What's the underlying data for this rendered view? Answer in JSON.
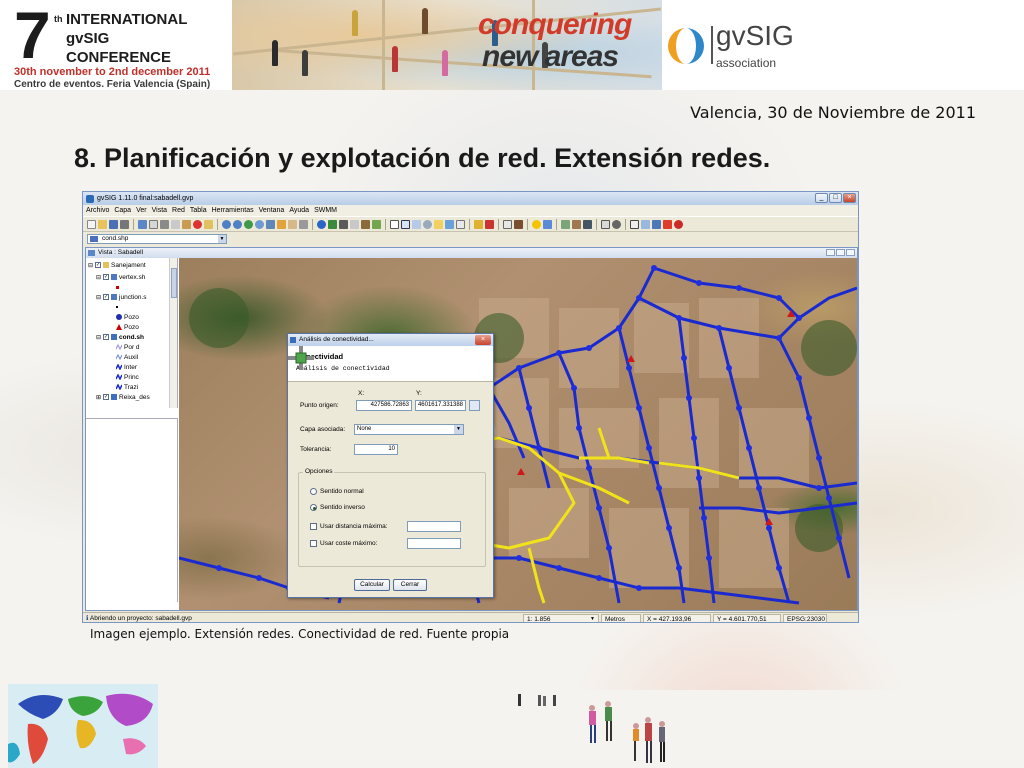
{
  "banner": {
    "seven": "7",
    "th": "th",
    "line1": "INTERNATIONAL",
    "line2": "gvSIG",
    "line3": "CONFERENCE",
    "dates": "30th november to 2nd december 2011",
    "venue": "Centro de eventos. Feria Valencia (Spain)",
    "slogan_line1": "conquering",
    "slogan_line2": "new areas",
    "org_name": "gvSIG",
    "org_subtitle": "association"
  },
  "date_line": "Valencia, 30 de Noviembre de 2011",
  "slide_title": "8. Planificación y explotación de red. Extensión redes.",
  "caption": "Imagen ejemplo. Extensión redes. Conectividad de red. Fuente propia",
  "app": {
    "title": "gvSIG 1.11.0 final:sabadell.gvp",
    "menu": [
      "Archivo",
      "Capa",
      "Ver",
      "Vista",
      "Red",
      "Tabla",
      "Herramientas",
      "Ventana",
      "Ayuda",
      "SWMM"
    ],
    "layer_combo": "cond.shp",
    "view_title": "Vista : Sabadell",
    "toc": [
      {
        "label": "Sanejament",
        "indent": 0,
        "symbol": "folder"
      },
      {
        "label": "vertex.sh",
        "indent": 1,
        "symbol": "layer"
      },
      {
        "label": "junction.s",
        "indent": 1,
        "symbol": "layer"
      },
      {
        "label": "Pozo",
        "indent": 2,
        "symbol": "circle"
      },
      {
        "label": "Pozo",
        "indent": 2,
        "symbol": "triangle"
      },
      {
        "label": "cond.sh",
        "indent": 1,
        "symbol": "layer"
      },
      {
        "label": "Por d",
        "indent": 2,
        "symbol": "line"
      },
      {
        "label": "Auxil",
        "indent": 2,
        "symbol": "line"
      },
      {
        "label": "Inter",
        "indent": 2,
        "symbol": "line"
      },
      {
        "label": "Princ",
        "indent": 2,
        "symbol": "line"
      },
      {
        "label": "Trazi",
        "indent": 2,
        "symbol": "line"
      },
      {
        "label": "Reixa_des",
        "indent": 1,
        "symbol": "layer"
      }
    ],
    "status": {
      "message": "Abriendo un proyecto: sabadell.gvp",
      "scale": "1: 1.856",
      "units": "Metros",
      "x": "X = 427.193,96",
      "y": "Y = 4.601.770,51",
      "epsg": "EPSG:23030"
    },
    "colors": {
      "network": "#1a2ad0",
      "highlight": "#f2e21a",
      "node": "#1f2fe0"
    }
  },
  "dialog": {
    "title": "Análisis de conectividad...",
    "heading": "Conectividad",
    "subheading": "Análisis de conectividad",
    "x_label": "X:",
    "y_label": "Y:",
    "origin_label": "Punto origen:",
    "x_value": "427586.72863",
    "y_value": "4601617.331388",
    "layer_label": "Capa asociada:",
    "layer_value": "None",
    "tolerance_label": "Tolerancia:",
    "tolerance_value": "10",
    "options_title": "Opciones",
    "opt_normal": "Sentido normal",
    "opt_inverse": "Sentido inverso",
    "opt_inverse_selected": true,
    "opt_maxdist": "Usar distancia máxima:",
    "opt_maxcost": "Usar coste máximo:",
    "btn_calc": "Calcular",
    "btn_close": "Cerrar"
  }
}
